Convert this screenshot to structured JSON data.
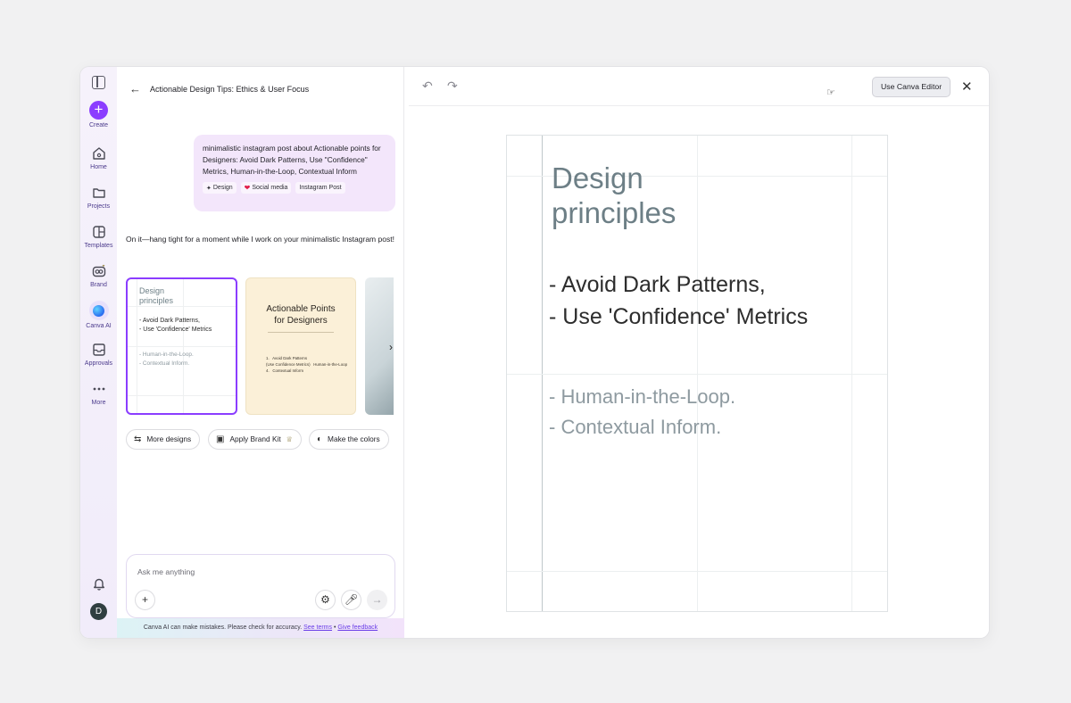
{
  "rail": {
    "create": "Create",
    "home": "Home",
    "projects": "Projects",
    "templates": "Templates",
    "brand": "Brand",
    "canva_ai": "Canva AI",
    "approvals": "Approvals",
    "more": "More",
    "avatar_initial": "D"
  },
  "chat": {
    "title": "Actionable Design Tips: Ethics & User Focus",
    "user_message": "minimalistic instagram post about Actionable points for Designers: Avoid Dark Patterns, Use \"Confidence\" Metrics, Human-in-the-Loop, Contextual Inform",
    "tags": [
      "Design",
      "Social media",
      "Instagram Post"
    ],
    "ai_message": "On it—hang tight for a moment while I work on your minimalistic Instagram post!",
    "card1": {
      "title": "Design\nprinciples",
      "dark": "- Avoid Dark Patterns,\n- Use 'Confidence' Metrics",
      "light": "- Human-in-the-Loop.\n- Contextual Inform."
    },
    "card2": {
      "title": "Actionable Points\nfor Designers",
      "list": "1.   Avoid Dark Patterns\n(Use Confidence Metrics)   Human-in-the-Loop\n4.   Contextual Inform"
    },
    "chips": [
      "More designs",
      "Apply Brand Kit",
      "Make the colors"
    ],
    "composer_placeholder": "Ask me anything",
    "footer_text": "Canva AI can make mistakes. Please check for accuracy.",
    "footer_terms": "See terms",
    "footer_sep": "•",
    "footer_feedback": "Give feedback"
  },
  "editor": {
    "use_editor": "Use Canva Editor",
    "canvas": {
      "title": "Design\nprinciples",
      "dark": "- Avoid Dark Patterns,\n- Use 'Confidence' Metrics",
      "light": "- Human-in-the-Loop.\n- Contextual Inform."
    }
  },
  "colors": {
    "accent": "#8b3dff",
    "title_gray": "#6d7f86",
    "bubble": "#f3e6fb"
  }
}
